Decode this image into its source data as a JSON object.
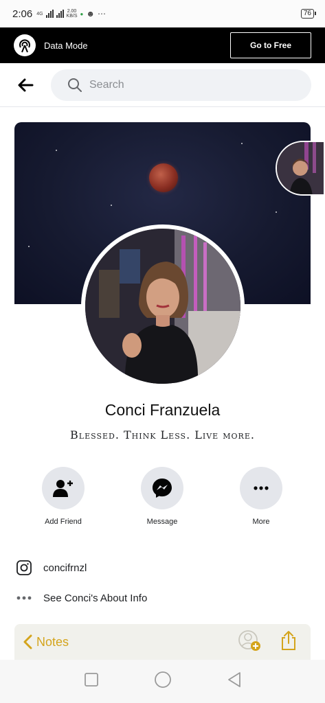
{
  "status_bar": {
    "time": "2:06",
    "net_label": "4G",
    "speed_value": "2.00",
    "speed_unit": "KB/S",
    "battery": "76"
  },
  "data_mode": {
    "label": "Data Mode",
    "button": "Go to Free"
  },
  "search": {
    "placeholder": "Search"
  },
  "profile": {
    "name": "Conci Franzuela",
    "bio": "Blessed. Think Less. Live more."
  },
  "actions": [
    {
      "label": "Add Friend",
      "icon": "add-friend-icon"
    },
    {
      "label": "Message",
      "icon": "messenger-icon"
    },
    {
      "label": "More",
      "icon": "more-icon"
    }
  ],
  "info": {
    "instagram": "concifrnzl",
    "about": "See Conci's About Info"
  },
  "notes_bar": {
    "back_label": "Notes"
  },
  "colors": {
    "accent_notes": "#d4a41c",
    "data_bar": "#000000",
    "button_bg": "#e4e6eb"
  }
}
